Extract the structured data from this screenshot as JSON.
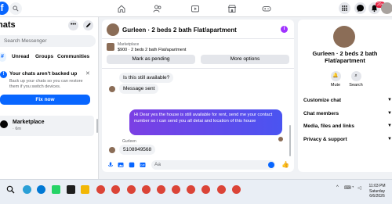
{
  "topbar": {
    "logo": "f",
    "notification_badge": "20+",
    "nav_icons": [
      "home-icon",
      "friends-icon",
      "video-icon",
      "marketplace-icon",
      "gaming-icon"
    ]
  },
  "left": {
    "title": "hats",
    "search_placeholder": "Search Messenger",
    "filters": [
      "Unread",
      "Groups",
      "Communities"
    ],
    "backup": {
      "title": "Your chats aren't backed up",
      "desc": "Back up your chats so you can restore them if you switch devices.",
      "button": "Fix now"
    },
    "chat": {
      "name": "Marketplace",
      "time": "· 6m"
    }
  },
  "conversation": {
    "title": "Gurleen · 2 beds 2 bath Flat/apartment",
    "listing_label": "Marketplace",
    "listing_price": "$900 · 2 beds 2 bath Flat/apartment",
    "mark_pending": "Mark as pending",
    "more_options": "More options",
    "messages": {
      "in1": "Is this still available?",
      "in2": "Message sent",
      "out": "Hi Dear yes the house is still available for rent, send me your contact number so i can send you all detai and location of this house",
      "sender": "Gurleen",
      "in3": "5108949568"
    },
    "composer_placeholder": "Aa"
  },
  "right": {
    "name": "Gurleen · 2 beds 2 bath Flat/apartment",
    "mute": "Mute",
    "search": "Search",
    "rows": [
      "Customize chat",
      "Chat members",
      "Media, files and links",
      "Privacy & support"
    ]
  },
  "taskbar": {
    "time": "11:03 PM",
    "day": "Saturday",
    "date": "6/6/2026"
  },
  "colors": {
    "accent": "#0866ff",
    "bubble_start": "#7b3fe4",
    "bubble_end": "#4a54f1"
  }
}
